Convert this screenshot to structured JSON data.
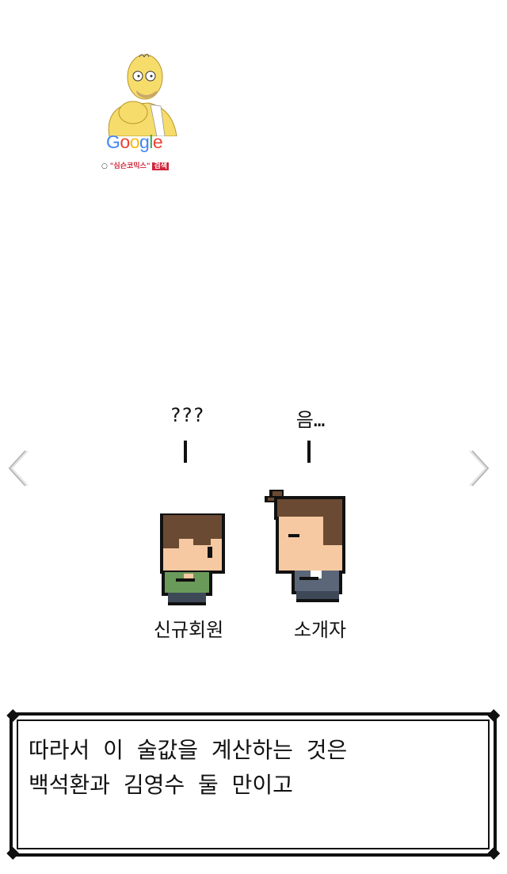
{
  "watermark": {
    "logo_text": "Google",
    "search_hint_quoted": "\"심슨코믹스\"",
    "search_button": "검색",
    "colors": [
      "#4285F4",
      "#EA4335",
      "#FBBC05",
      "#4285F4",
      "#34A853",
      "#EA4335"
    ]
  },
  "navigation": {
    "prev_icon": "chevron-left-icon",
    "next_icon": "chevron-right-icon"
  },
  "scene": {
    "left_character": {
      "speech": "???",
      "name": "신규회원"
    },
    "right_character": {
      "speech": "음…",
      "name": "소개자"
    }
  },
  "dialog": {
    "line1": "따라서 이 술값을 계산하는 것은",
    "line2": "백석환과 김영수 둘 만이고"
  }
}
